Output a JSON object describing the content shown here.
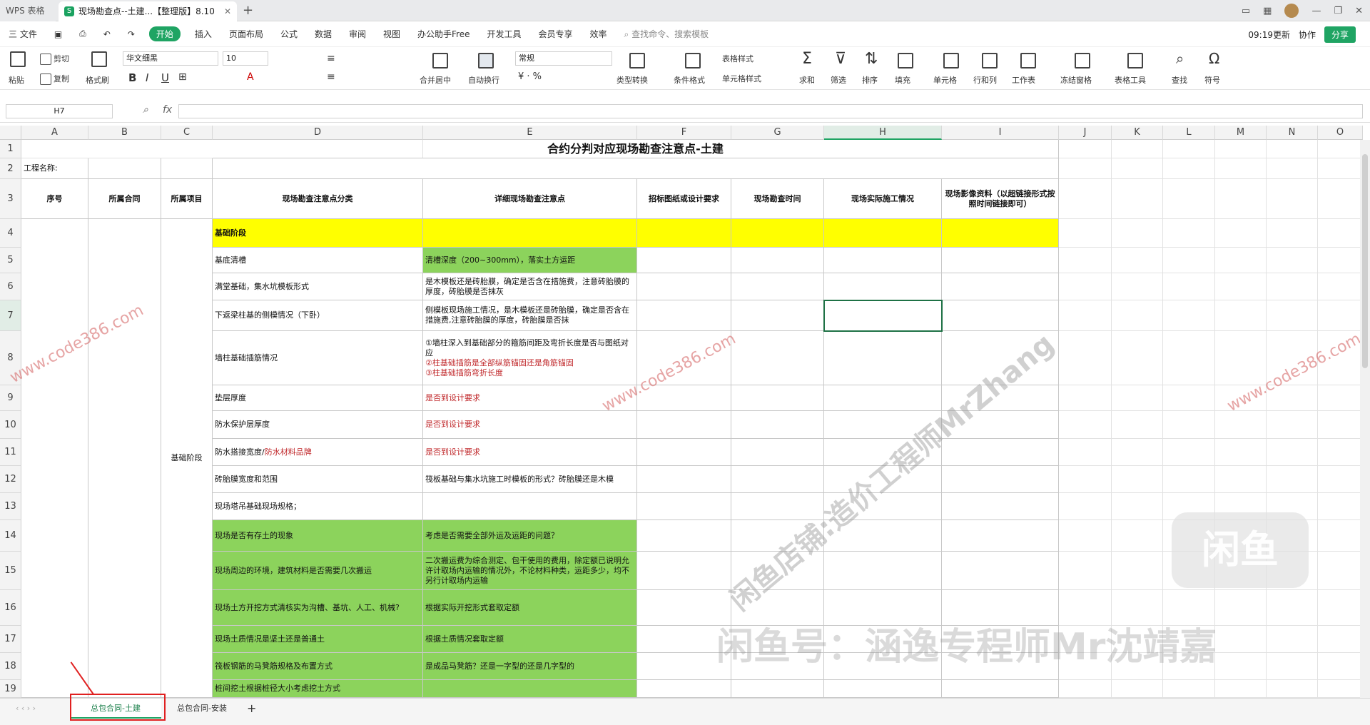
{
  "window": {
    "app_label": "WPS 表格",
    "doc_tab_title": "现场勘查点--土建...【整理版】8.10",
    "doc_tab_icon": "S",
    "new_tab": "+"
  },
  "menu": {
    "file": "三 文件",
    "start": "开始",
    "items": [
      "插入",
      "页面布局",
      "公式",
      "数据",
      "审阅",
      "视图",
      "办公助手Free",
      "开发工具",
      "会员专享",
      "效率"
    ],
    "search": "查找命令、搜索模板",
    "update": "09:19更新",
    "collab": "协作",
    "share": "分享"
  },
  "ribbon": {
    "paste": "粘贴",
    "cut": "剪切",
    "copy": "复制",
    "format_painter": "格式刷",
    "font_name": "华文细黑",
    "font_size": "10",
    "merge_center": "合并居中",
    "wrap": "自动换行",
    "number_format": "常规",
    "convert": "类型转换",
    "cond_format": "条件格式",
    "table_style": "表格样式",
    "cell_style": "单元格样式",
    "sum": "求和",
    "filter": "筛选",
    "sort": "排序",
    "fill": "填充",
    "cell": "单元格",
    "rowcol": "行和列",
    "worksheet": "工作表",
    "freeze": "冻结窗格",
    "table_tools": "表格工具",
    "find": "查找",
    "symbol": "符号"
  },
  "formula": {
    "name_box": "H7",
    "fx": "fx",
    "value": ""
  },
  "columns": [
    "A",
    "B",
    "C",
    "D",
    "E",
    "F",
    "G",
    "H",
    "I",
    "J",
    "K",
    "L",
    "M",
    "N",
    "O"
  ],
  "rows": [
    "1",
    "2",
    "3",
    "4",
    "5",
    "6",
    "7",
    "8",
    "9",
    "10",
    "11",
    "12",
    "13",
    "14",
    "15",
    "16",
    "17",
    "18",
    "19"
  ],
  "sheet": {
    "title": "合约分判对应现场勘查注意点-土建",
    "project_label": "工程名称:",
    "headers": {
      "seq": "序号",
      "contract": "所属合同",
      "item": "所属项目",
      "category": "现场勘查注意点分类",
      "detail": "详细现场勘查注意点",
      "drawing": "招标图纸或设计要求",
      "time": "现场勘查时间",
      "actual": "现场实际施工情况",
      "photo": "现场影像资料（以超链接形式按照时间链接即可）"
    },
    "merged_item": "基础阶段",
    "data": [
      {
        "cat": "基础阶段",
        "detail": ""
      },
      {
        "cat": "基底清槽",
        "detail": "清槽深度（200~300mm），落实土方运距"
      },
      {
        "cat": "满堂基础，集水坑模板形式",
        "detail": "是木模板还是砖胎膜，确定是否含在措施费，注意砖胎膜的厚度，砖胎膜是否抹灰"
      },
      {
        "cat": "下返梁柱基的侧模情况（下卧）",
        "detail": "侧模板现场施工情况，是木模板还是砖胎膜，确定是否含在措施费,注意砖胎膜的厚度，砖胎膜是否抹"
      },
      {
        "cat": "墙柱基础插筋情况",
        "detail": "①墙柱深入到基础部分的箍筋间距及弯折长度是否与图纸对应",
        "detail2": "②柱基础插筋是全部纵筋锚固还是角筋锚固",
        "detail3": "③柱基础插筋弯折长度"
      },
      {
        "cat": "垫层厚度",
        "detail": "是否到设计要求"
      },
      {
        "cat": "防水保护层厚度",
        "detail": "是否到设计要求"
      },
      {
        "cat": "防水搭接宽度/",
        "cat_red": "防水材料品牌",
        "detail": "是否到设计要求"
      },
      {
        "cat": "砖胎膜宽度和范围",
        "detail": "筏板基础与集水坑施工时模板的形式？砖胎膜还是木模"
      },
      {
        "cat": "现场塔吊基础现场规格；",
        "detail": ""
      },
      {
        "cat": "现场是否有存土的现象",
        "detail": "考虑是否需要全部外运及运距的问题？"
      },
      {
        "cat": "现场周边的环境，建筑材料是否需要几次搬运",
        "detail": "二次搬运费为综合测定、包干使用的费用，除定额已说明允许计取场内运输的情况外，不论材料种类，运距多少，均不另行计取场内运输"
      },
      {
        "cat": "现场土方开挖方式清核实为沟槽、基坑、人工、机械?",
        "detail": "根据实际开挖形式套取定额"
      },
      {
        "cat": "现场土质情况是坚土还是普通土",
        "detail": "根据土质情况套取定额"
      },
      {
        "cat": "筏板钢筋的马凳筋规格及布置方式",
        "detail": "是成品马凳筋？还是一字型的还是几字型的"
      },
      {
        "cat": "桩间挖土根据桩径大小考虑挖土方式",
        "detail": ""
      }
    ]
  },
  "tabs": {
    "sheet1": "总包合同-土建",
    "sheet2": "总包合同-安装",
    "add": "+"
  },
  "watermarks": {
    "site": "www.code386.com",
    "shop": "闲鱼店铺:造价工程师MrZhang",
    "xianyu_id": "闲鱼号：涵逸专程师Mr沈靖嘉",
    "logo": "闲鱼"
  }
}
